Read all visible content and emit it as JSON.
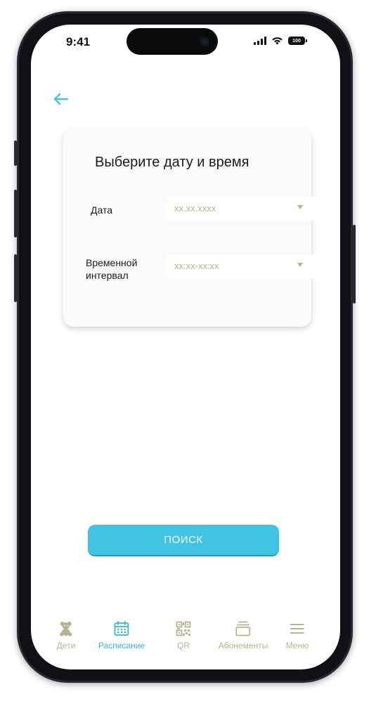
{
  "status_bar": {
    "time": "9:41",
    "battery": "100"
  },
  "colors": {
    "accent": "#41c4e4",
    "muted": "#b5b48f",
    "text": "#1b1b1b"
  },
  "card": {
    "title": "Выберите дату и время",
    "fields": [
      {
        "label": "Дата",
        "value": "xx.xx.xxxx"
      },
      {
        "label": "Временной интервал",
        "value": "xx:xx-xx:xx"
      }
    ]
  },
  "search_button": {
    "label": "ПОИСК"
  },
  "tabbar": {
    "items": [
      {
        "label": "Дети",
        "icon": "teddy-bear-icon",
        "active": false
      },
      {
        "label": "Расписание",
        "icon": "calendar-icon",
        "active": true
      },
      {
        "label": "QR",
        "icon": "qr-code-icon",
        "active": false
      },
      {
        "label": "Абонементы",
        "icon": "subscriptions-icon",
        "active": false
      },
      {
        "label": "Меню",
        "icon": "menu-icon",
        "active": false
      }
    ]
  }
}
